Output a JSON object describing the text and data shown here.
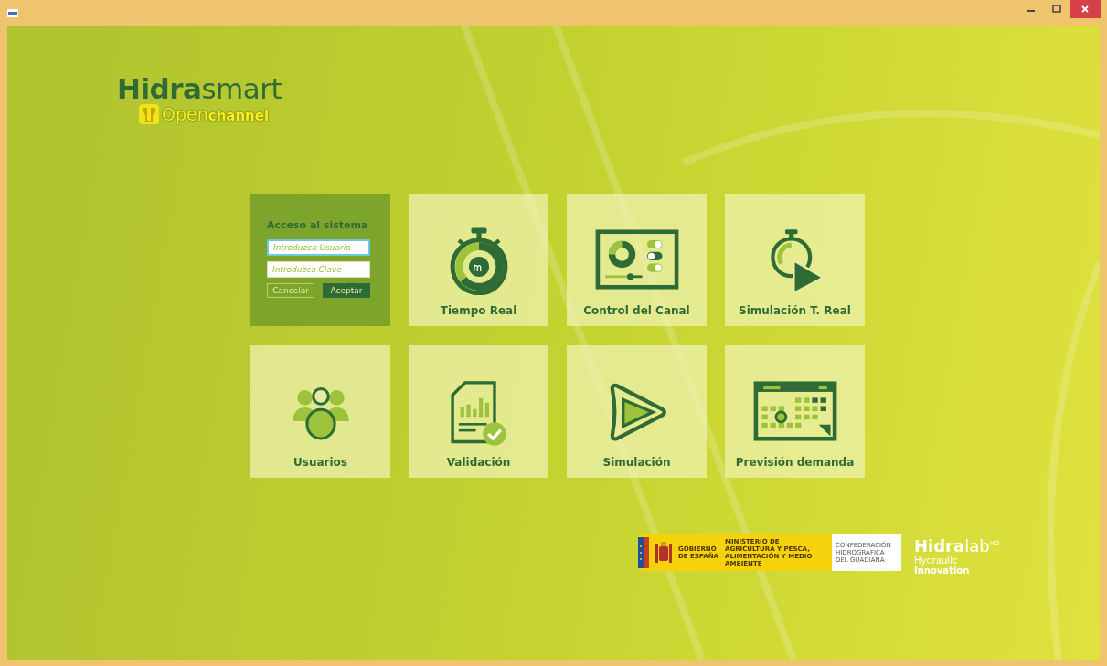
{
  "logo": {
    "brand_bold": "Hidra",
    "brand_light": "smart",
    "sub_light": "Open",
    "sub_bold": "channel"
  },
  "login": {
    "title": "Acceso al sistema",
    "user_placeholder": "Introduzca Usuario",
    "password_placeholder": "Introduzca Clave",
    "buttons": [
      {
        "label": "Cancelar",
        "disabled": true
      },
      {
        "label": "Aceptar",
        "disabled": false
      }
    ]
  },
  "tiles": [
    {
      "label": "Tiempo Real",
      "kind": "stopwatch-m3"
    },
    {
      "label": "Control del Canal",
      "kind": "control-panel"
    },
    {
      "label": "Simulación T. Real",
      "kind": "stopwatch-play"
    },
    {
      "label": "Usuarios",
      "kind": "users"
    },
    {
      "label": "Validación",
      "kind": "report"
    },
    {
      "label": "Simulación",
      "kind": "play"
    },
    {
      "label": "Previsión demanda",
      "kind": "calendar"
    }
  ],
  "footer": {
    "gov": "GOBIERNO DE ESPAÑA",
    "ministry": "MINISTERIO DE AGRICULTURA Y PESCA, ALIMENTACIÓN Y MEDIO AMBIENTE",
    "confederation": "CONFEDERACIÓN HIDROGRÁFICA DEL GUADIANA",
    "lab_bold": "Hidra",
    "lab_light": "lab",
    "lab_sup": "HD",
    "tag1": "Hydraulic",
    "tag2": "Innovation"
  }
}
